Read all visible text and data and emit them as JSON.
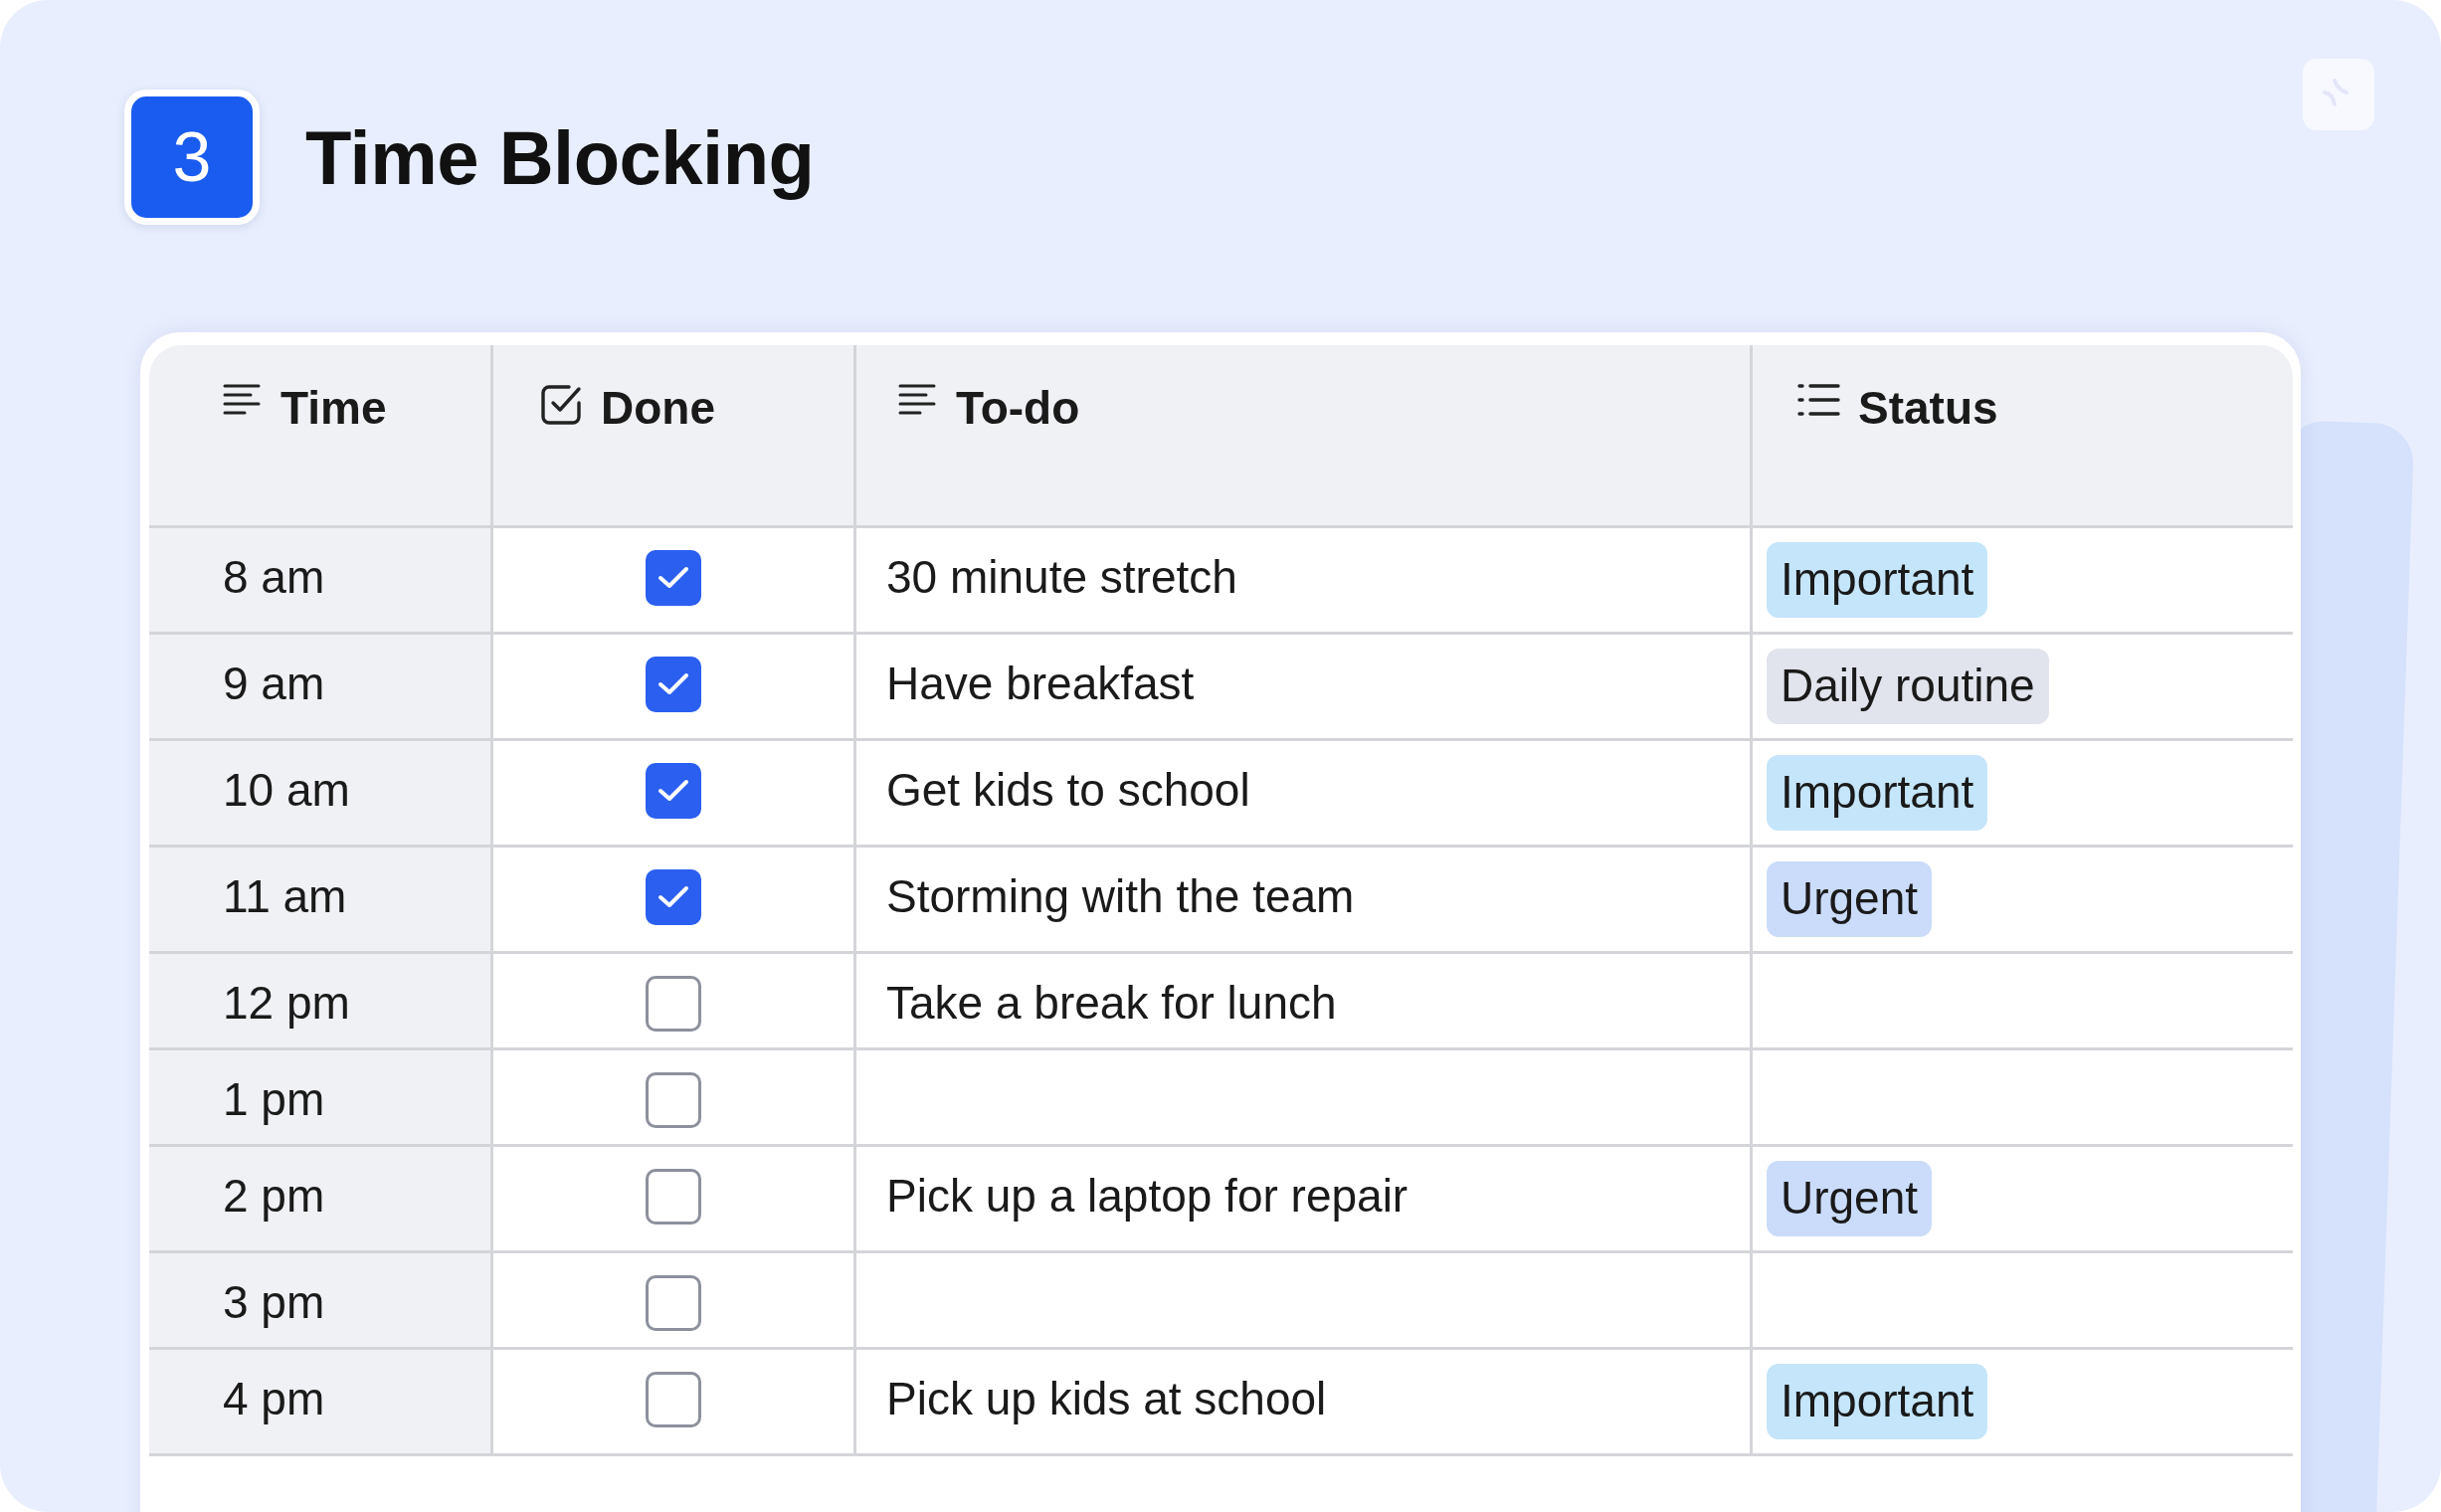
{
  "badge": "3",
  "title": "Time Blocking",
  "columns": [
    {
      "label": "Time",
      "kind": "lines"
    },
    {
      "label": "Done",
      "kind": "checkbox"
    },
    {
      "label": "To-do",
      "kind": "lines"
    },
    {
      "label": "Status",
      "kind": "list"
    }
  ],
  "rows": [
    {
      "time": "8 am",
      "done": true,
      "todo": "30 minute stretch",
      "status": {
        "label": "Important",
        "color": "#c4e5fa"
      }
    },
    {
      "time": "9 am",
      "done": true,
      "todo": "Have breakfast",
      "status": {
        "label": "Daily routine",
        "color": "#e1e4ec"
      }
    },
    {
      "time": "10 am",
      "done": true,
      "todo": "Get kids to school",
      "status": {
        "label": "Important",
        "color": "#c4e5fa"
      }
    },
    {
      "time": "11 am",
      "done": true,
      "todo": "Storming with the team",
      "status": {
        "label": "Urgent",
        "color": "#cadcfa"
      }
    },
    {
      "time": "12 pm",
      "done": false,
      "todo": "Take a break for lunch"
    },
    {
      "time": "1 pm",
      "done": false
    },
    {
      "time": "2 pm",
      "done": false,
      "todo": "Pick up a laptop for repair",
      "status": {
        "label": "Urgent",
        "color": "#cadcfa"
      }
    },
    {
      "time": "3 pm",
      "done": false
    },
    {
      "time": "4 pm",
      "done": false,
      "todo": "Pick up kids at school",
      "status": {
        "label": "Important",
        "color": "#c4e5fa"
      }
    }
  ]
}
